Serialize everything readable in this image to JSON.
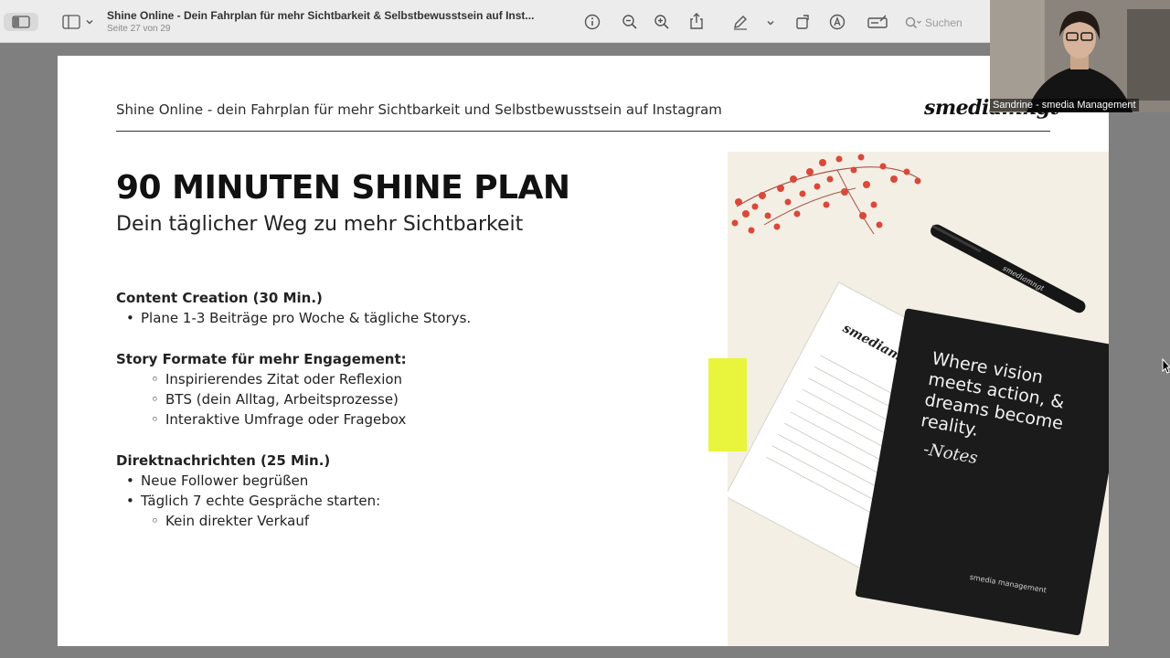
{
  "toolbar": {
    "doc_title": "Shine Online - Dein Fahrplan für mehr Sichtbarkeit & Selbstbewusstsein auf Inst...",
    "page_info": "Seite 27 von 29",
    "search_placeholder": "Suchen"
  },
  "slide": {
    "header": "Shine Online - dein Fahrplan für mehr Sichtbarkeit und Selbstbewusstsein auf Instagram",
    "logo": "smediamngt",
    "title": "90 MINUTEN SHINE PLAN",
    "subtitle": "Dein täglicher Weg zu mehr Sichtbarkeit",
    "sections": [
      {
        "heading": "Content Creation (30 Min.)",
        "items": [
          {
            "level": 1,
            "text": "Plane 1-3 Beiträge pro Woche & tägliche Storys."
          }
        ]
      },
      {
        "heading": "Story Formate für mehr Engagement:",
        "items": [
          {
            "level": 2,
            "text": "Inspirierendes Zitat oder Reflexion"
          },
          {
            "level": 2,
            "text": "BTS (dein Alltag, Arbeitsprozesse)"
          },
          {
            "level": 2,
            "text": "Interaktive Umfrage oder Fragebox"
          }
        ]
      },
      {
        "heading": "Direktnachrichten (25 Min.)",
        "items": [
          {
            "level": 1,
            "text": "Neue Follower begrüßen"
          },
          {
            "level": 1,
            "text": "Täglich 7 echte Gespräche starten:"
          },
          {
            "level": 2,
            "text": "Kein direkter Verkauf"
          }
        ]
      }
    ],
    "photo": {
      "notebook_quote": [
        "Where vision",
        "meets action, &",
        "dreams become",
        "reality."
      ],
      "notebook_signature": "-Notes",
      "notebook_brand": "smedia management",
      "notepad_logo": "smediamngt",
      "pen_logo": "smediamngt"
    }
  },
  "webcam": {
    "participant_name": "Sandrine - smedia Management"
  },
  "colors": {
    "sticky_note": "#e8f53c",
    "flowers": "#d9493a",
    "notebook": "#1b1b1b"
  }
}
